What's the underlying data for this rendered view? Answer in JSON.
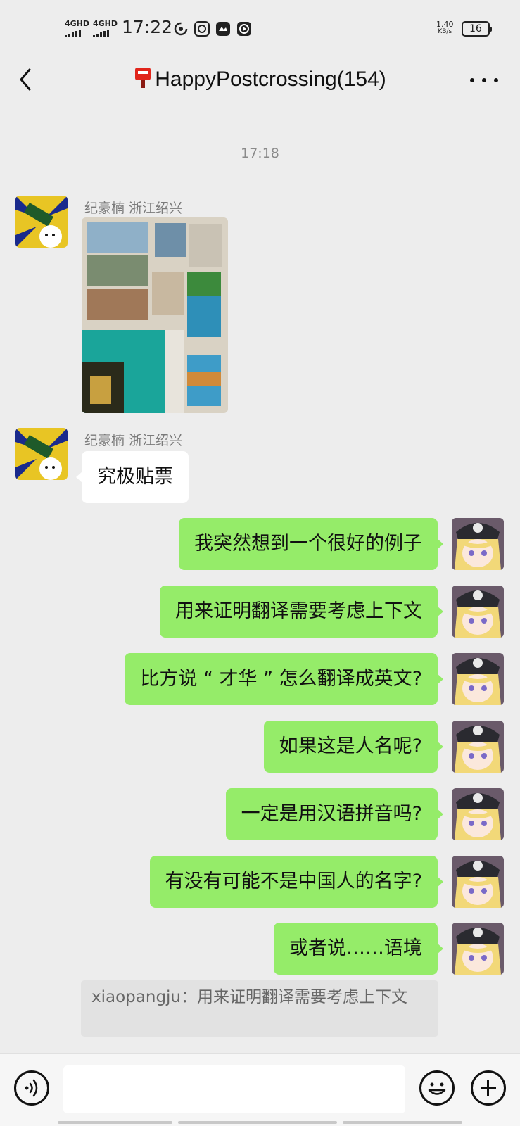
{
  "status_bar": {
    "signal_1": "4GHD",
    "signal_2": "4GHD",
    "time": "17:22",
    "net_speed_value": "1.40",
    "net_speed_unit": "KB/s",
    "battery": "16"
  },
  "header": {
    "title": "HappyPostcrossing(154)",
    "back_icon": "chevron-left-icon",
    "more_icon": "more-dots-icon",
    "title_icon": "mailbox-emoji-icon"
  },
  "chat": {
    "timestamp": "17:18",
    "incoming": [
      {
        "sender": "纪豪楠 浙江绍兴",
        "type": "image",
        "image_desc": "stamps-photo"
      },
      {
        "sender": "纪豪楠 浙江绍兴",
        "type": "text",
        "text": "究极贴票"
      }
    ],
    "outgoing": [
      "我突然想到一个很好的例子",
      "用来证明翻译需要考虑上下文",
      "比方说 “ 才华 ” 怎么翻译成英文?",
      "如果这是人名呢?",
      "一定是用汉语拼音吗?",
      "有没有可能不是中国人的名字?",
      "或者说……语境"
    ],
    "quote": "xiaopangju：用来证明翻译需要考虑上下文"
  },
  "input_bar": {
    "voice_icon": "voice-icon",
    "emoji_icon": "emoji-icon",
    "plus_icon": "plus-icon",
    "input_value": ""
  },
  "colors": {
    "background": "#ededed",
    "outgoing_bubble": "#95ec69",
    "incoming_bubble": "#ffffff",
    "title_icon_red": "#e1251b"
  }
}
